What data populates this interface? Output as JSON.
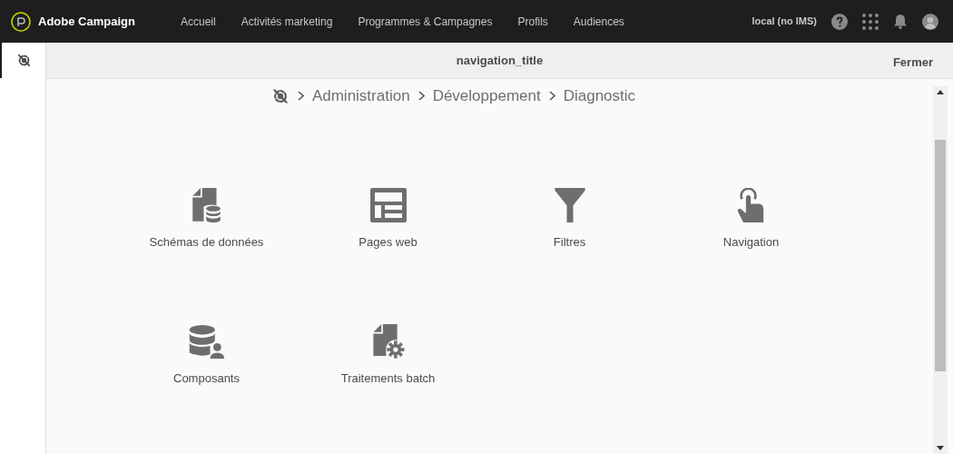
{
  "topbar": {
    "brand": "Adobe Campaign",
    "menu": [
      "Accueil",
      "Activités marketing",
      "Programmes & Campagnes",
      "Profils",
      "Audiences"
    ],
    "user": "local (no IMS)"
  },
  "dialog": {
    "title": "navigation_title",
    "close": "Fermer",
    "breadcrumb": [
      "Administration",
      "Développement",
      "Diagnostic"
    ],
    "tiles": [
      {
        "label": "Schémas de données",
        "kind": "schema"
      },
      {
        "label": "Pages web",
        "kind": "webpage"
      },
      {
        "label": "Filtres",
        "kind": "filter"
      },
      {
        "label": "Navigation",
        "kind": "navigation"
      },
      {
        "label": "Composants",
        "kind": "component"
      },
      {
        "label": "Traitements batch",
        "kind": "batch"
      }
    ]
  }
}
